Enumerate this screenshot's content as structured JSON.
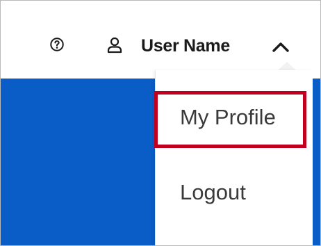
{
  "header": {
    "help_icon": "help-circle-icon",
    "user_icon": "person-icon",
    "user_name": "User Name",
    "toggle_icon": "chevron-up-icon"
  },
  "user_menu": {
    "items": [
      {
        "label": "My Profile",
        "highlighted": true
      },
      {
        "label": "Logout",
        "highlighted": false
      }
    ]
  },
  "colors": {
    "brand_blue": "#0a5cc6",
    "highlight_red": "#c0001e",
    "text": "#1a1a1a"
  }
}
